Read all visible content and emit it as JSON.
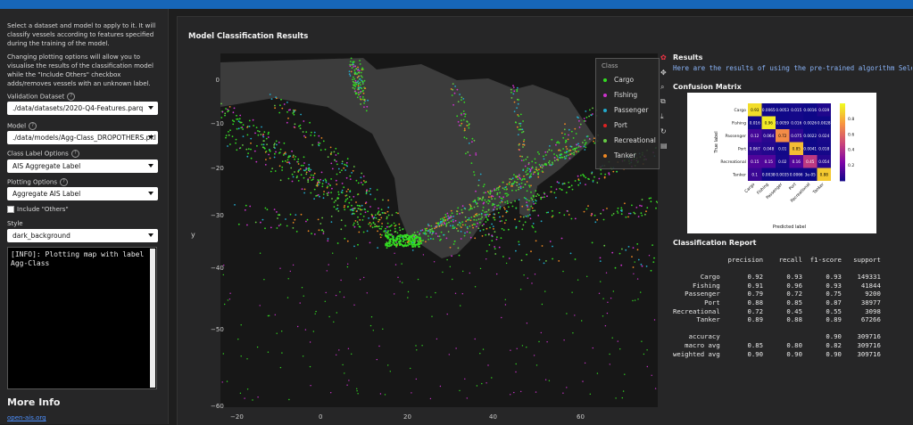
{
  "sidebar": {
    "intro": "Select a dataset and model to apply to it. It will classify vessels according to features specified during the training of the model.",
    "plotting_note": "Changing plotting options will allow you to visualise the results of the classification model while the \"Include Others\" checkbox adds/removes vessels with an unknown label.",
    "validation_label": "Validation Dataset",
    "validation_value": "./data/datasets/2020-Q4-Features.parq",
    "model_label": "Model",
    "model_value": "./data/models/Agg-Class_DROPOTHERS.pkl",
    "class_label": "Class Label Options",
    "class_value": "AIS Aggregate Label",
    "plotting_label": "Plotting Options",
    "plotting_value": "Aggregate AIS Label",
    "include_others": "Include \"Others\"",
    "style_label": "Style",
    "style_value": "dark_background",
    "log_text": "[INFO]: Plotting map with label\nAgg-Class",
    "more_info": "More Info",
    "link": "open-ais.org"
  },
  "main": {
    "title": "Model Classification Results",
    "results_title": "Results",
    "results_text": "Here are the results of using the pre-trained algorithm Select(descri",
    "cm_title": "Confusion Matrix",
    "cr_title": "Classification Report"
  },
  "colors": {
    "cargo": "#33dd22",
    "fishing": "#cc33cc",
    "passenger": "#22aacc",
    "port": "#dd2222",
    "recreational": "#66cc44",
    "tanker": "#ee8822"
  },
  "chart_data": {
    "type": "scatter",
    "legend_title": "Class",
    "legend": [
      "Cargo",
      "Fishing",
      "Passenger",
      "Port",
      "Recreational",
      "Tanker"
    ],
    "xlabel": "",
    "ylabel": "y",
    "xticks": [
      "−20",
      "0",
      "20",
      "40",
      "60"
    ],
    "yticks": [
      "0",
      "−10",
      "−20",
      "−30",
      "−40",
      "−50",
      "−60"
    ],
    "xlim": [
      -25,
      80
    ],
    "ylim": [
      -62,
      5
    ]
  },
  "confusion_matrix": {
    "labels": [
      "Cargo",
      "Fishing",
      "Passenger",
      "Port",
      "Recreational",
      "Tanker"
    ],
    "values": [
      [
        "0.93",
        "0.0065",
        "0.0053",
        "0.015",
        "0.0016",
        "0.039"
      ],
      [
        "0.016",
        "0.96",
        "0.0059",
        "0.016",
        "0.0026",
        "0.0028"
      ],
      [
        "0.12",
        "0.064",
        "0.72",
        "0.075",
        "0.0022",
        "0.024"
      ],
      [
        "0.067",
        "0.048",
        "0.01",
        "0.85",
        "0.0041",
        "0.018"
      ],
      [
        "0.15",
        "0.15",
        "0.02",
        "0.16",
        "0.45",
        "0.054"
      ],
      [
        "0.1",
        "0.0038",
        "0.0035",
        "0.0066",
        "3e-05",
        "0.88"
      ]
    ],
    "xlabel": "Predicted label",
    "ylabel": "True label",
    "colorbar": [
      "0.8",
      "0.6",
      "0.4",
      "0.2"
    ]
  },
  "report": {
    "text": "              precision    recall  f1-score   support\n\n       Cargo       0.92      0.93      0.93    149331\n     Fishing       0.91      0.96      0.93     41844\n   Passenger       0.79      0.72      0.75      9200\n        Port       0.88      0.85      0.87     38977\nRecreational       0.72      0.45      0.55      3098\n      Tanker       0.89      0.88      0.89     67266\n\n    accuracy                           0.90    309716\n   macro avg       0.85      0.80      0.82    309716\nweighted avg       0.90      0.90      0.90    309716"
  }
}
